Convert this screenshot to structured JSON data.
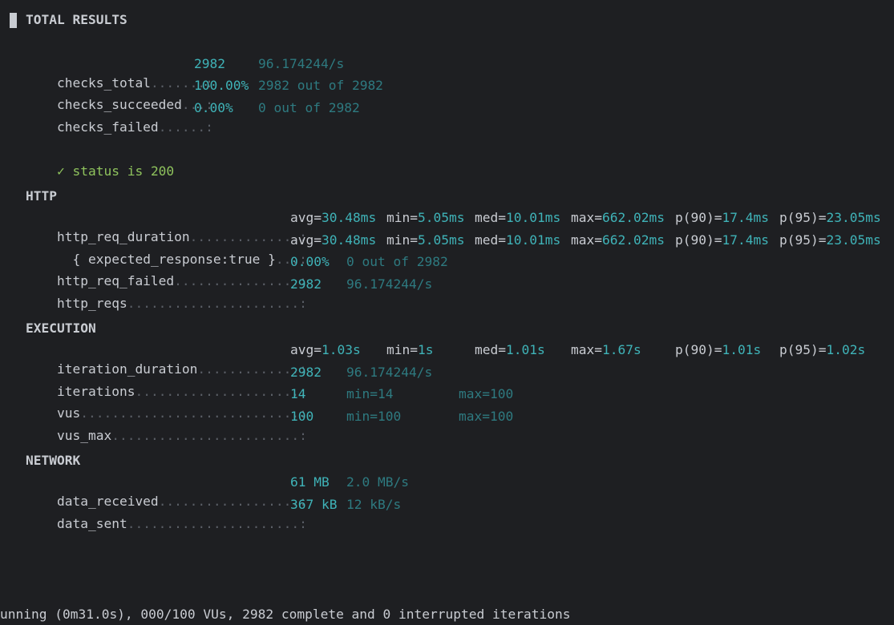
{
  "title": "TOTAL RESULTS",
  "checks": {
    "total": {
      "name": "checks_total",
      "dots": ".......:",
      "value": "2982",
      "rate": "96.174244/s"
    },
    "succeeded": {
      "name": "checks_succeeded",
      "dots": "...:",
      "value": "100.00%",
      "detail": "2982 out of 2982"
    },
    "failed": {
      "name": "checks_failed",
      "dots": "......:",
      "value": "0.00%",
      "detail": "0 out of 2982"
    }
  },
  "check_status": {
    "glyph": "✓",
    "text": "status is 200"
  },
  "http": {
    "heading": "HTTP",
    "req_duration": {
      "name": "http_req_duration",
      "dots": "..............:",
      "avg_k": "avg=",
      "avg": "30.48ms",
      "min_k": "min=",
      "min": "5.05ms",
      "med_k": "med=",
      "med": "10.01ms",
      "max_k": "max=",
      "max": "662.02ms",
      "p90_k": "p(90)=",
      "p90": "17.4ms",
      "p95_k": "p(95)=",
      "p95": "23.05ms"
    },
    "expected": {
      "name": "{ expected_response:true }",
      "dots": "...:",
      "avg_k": "avg=",
      "avg": "30.48ms",
      "min_k": "min=",
      "min": "5.05ms",
      "med_k": "med=",
      "med": "10.01ms",
      "max_k": "max=",
      "max": "662.02ms",
      "p90_k": "p(90)=",
      "p90": "17.4ms",
      "p95_k": "p(95)=",
      "p95": "23.05ms"
    },
    "req_failed": {
      "name": "http_req_failed",
      "dots": "................:",
      "value": "0.00%",
      "detail": "0 out of 2982"
    },
    "reqs": {
      "name": "http_reqs",
      "dots": "......................:",
      "value": "2982",
      "rate": "96.174244/s"
    }
  },
  "execution": {
    "heading": "EXECUTION",
    "iteration_duration": {
      "name": "iteration_duration",
      "dots": ".............:",
      "avg_k": "avg=",
      "avg": "1.03s",
      "min_k": "min=",
      "min": "1s",
      "med_k": "med=",
      "med": "1.01s",
      "max_k": "max=",
      "max": "1.67s",
      "p90_k": "p(90)=",
      "p90": "1.01s",
      "p95_k": "p(95)=",
      "p95": "1.02s"
    },
    "iterations": {
      "name": "iterations",
      "dots": ".....................:",
      "value": "2982",
      "rate": "96.174244/s"
    },
    "vus": {
      "name": "vus",
      "dots": "............................:",
      "value": "14",
      "min": "min=14",
      "max": "max=100"
    },
    "vus_max": {
      "name": "vus_max",
      "dots": "........................:",
      "value": "100",
      "min": "min=100",
      "max": "max=100"
    }
  },
  "network": {
    "heading": "NETWORK",
    "data_received": {
      "name": "data_received",
      "dots": "..................:",
      "value": "61 MB",
      "rate": "2.0 MB/s"
    },
    "data_sent": {
      "name": "data_sent",
      "dots": "......................:",
      "value": "367 kB",
      "rate": "12 kB/s"
    }
  },
  "status_line": "unning (0m31.0s), 000/100 VUs, 2982 complete and 0 interrupted iterations",
  "colors": {
    "background": "#1e1f22",
    "text": "#c9ccd2",
    "value": "#3fb3b8",
    "dim_value": "#2e7a80",
    "success": "#8fc35d"
  }
}
